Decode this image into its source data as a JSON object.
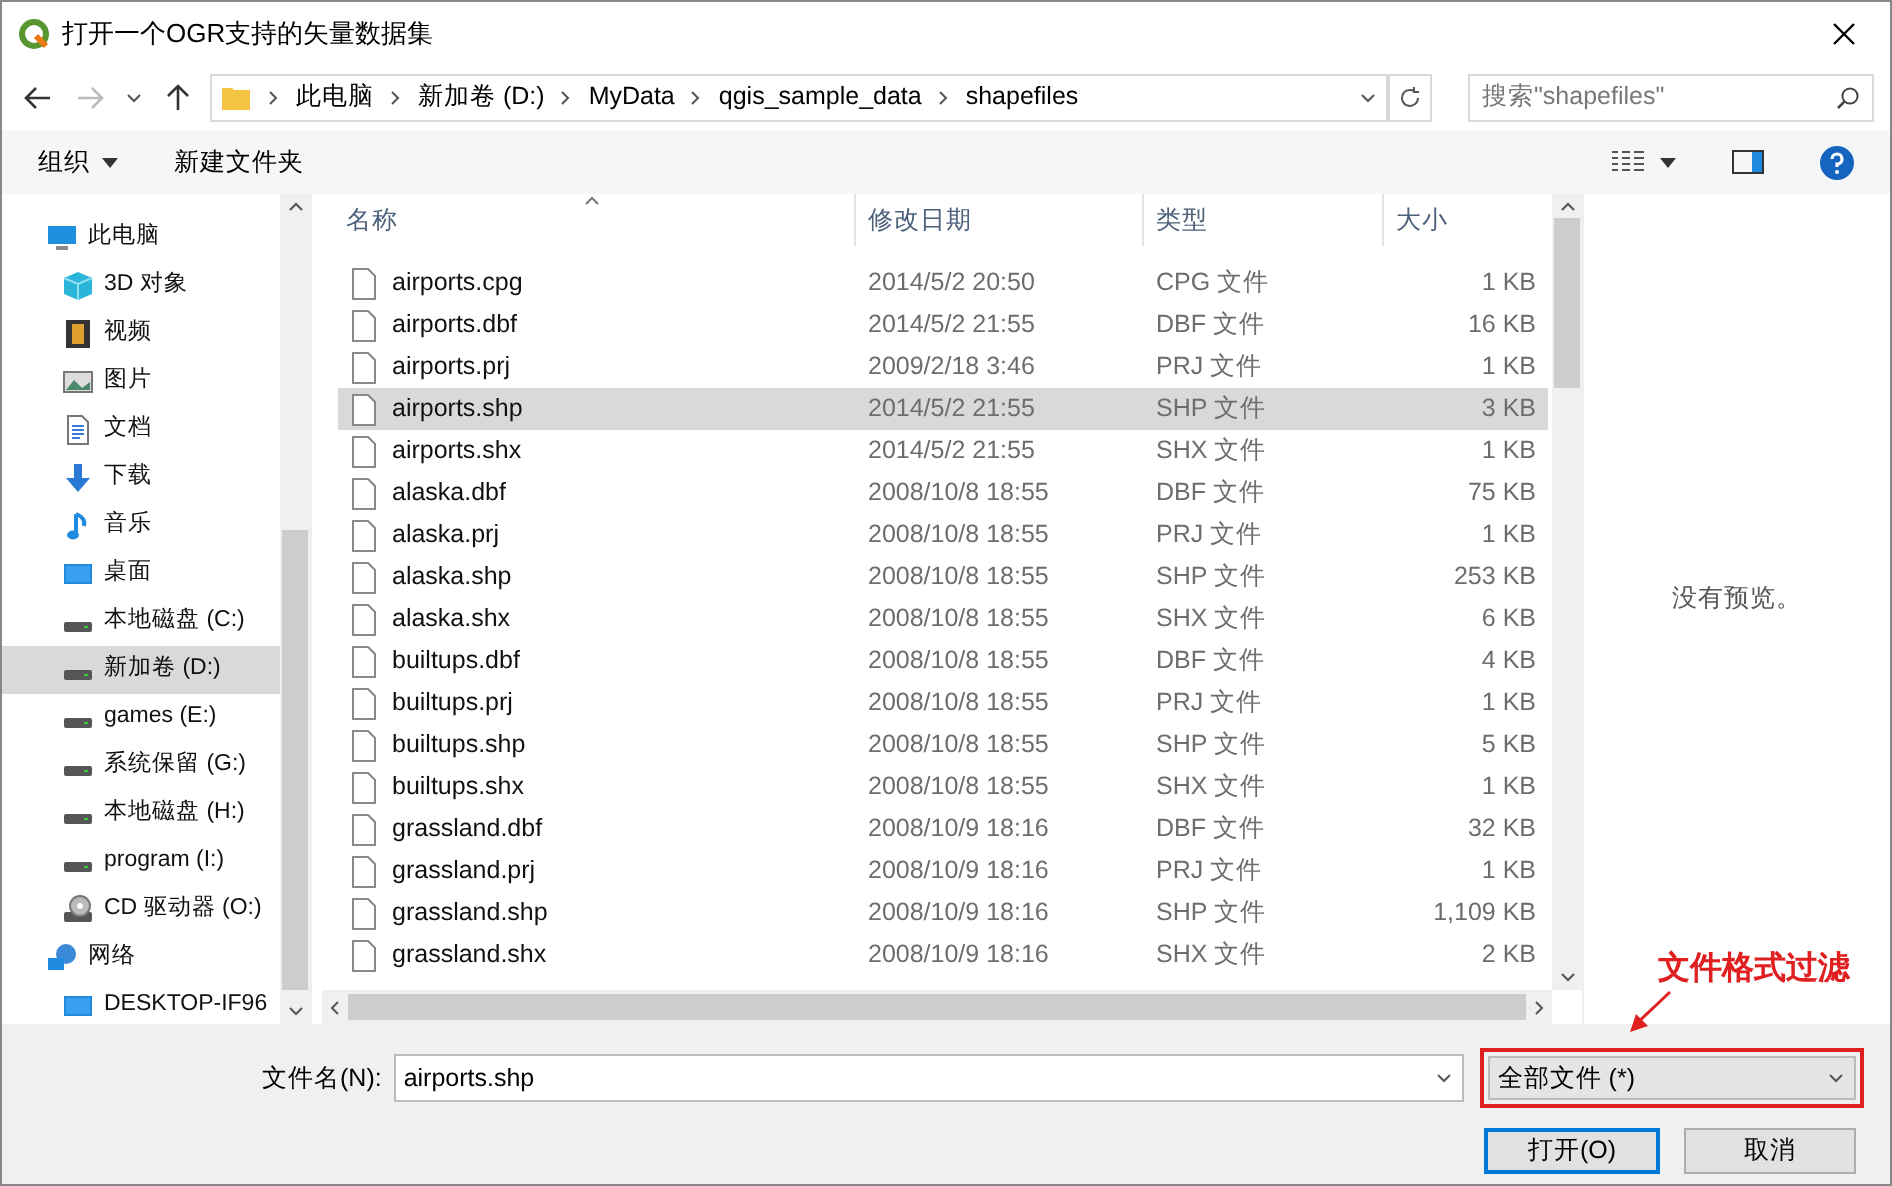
{
  "window": {
    "title": "打开一个OGR支持的矢量数据集"
  },
  "address": {
    "crumbs": [
      "此电脑",
      "新加卷 (D:)",
      "MyData",
      "qgis_sample_data",
      "shapefiles"
    ]
  },
  "search": {
    "placeholder": "搜索\"shapefiles\""
  },
  "toolbar": {
    "organize": "组织",
    "new_folder": "新建文件夹"
  },
  "sidebar": {
    "items": [
      {
        "label": "此电脑",
        "kind": "computer",
        "selected": false,
        "children": [
          {
            "label": "3D 对象",
            "kind": "cube",
            "selected": false
          },
          {
            "label": "视频",
            "kind": "video",
            "selected": false
          },
          {
            "label": "图片",
            "kind": "image",
            "selected": false
          },
          {
            "label": "文档",
            "kind": "document",
            "selected": false
          },
          {
            "label": "下载",
            "kind": "download",
            "selected": false
          },
          {
            "label": "音乐",
            "kind": "music",
            "selected": false
          },
          {
            "label": "桌面",
            "kind": "desktop",
            "selected": false
          },
          {
            "label": "本地磁盘 (C:)",
            "kind": "drive",
            "selected": false
          },
          {
            "label": "新加卷 (D:)",
            "kind": "drive",
            "selected": true
          },
          {
            "label": "games (E:)",
            "kind": "drive",
            "selected": false
          },
          {
            "label": "系统保留 (G:)",
            "kind": "drive",
            "selected": false
          },
          {
            "label": "本地磁盘 (H:)",
            "kind": "drive",
            "selected": false
          },
          {
            "label": "program (I:)",
            "kind": "drive",
            "selected": false
          },
          {
            "label": "CD 驱动器 (O:)",
            "kind": "cd",
            "selected": false
          }
        ]
      },
      {
        "label": "网络",
        "kind": "network",
        "selected": false,
        "children": [
          {
            "label": "DESKTOP-IF96",
            "kind": "desktop",
            "selected": false
          }
        ]
      }
    ]
  },
  "table": {
    "columns": [
      "名称",
      "修改日期",
      "类型",
      "大小"
    ],
    "rows": [
      {
        "name": "airports.cpg",
        "date": "2014/5/2 20:50",
        "type": "CPG 文件",
        "size": "1 KB",
        "selected": false
      },
      {
        "name": "airports.dbf",
        "date": "2014/5/2 21:55",
        "type": "DBF 文件",
        "size": "16 KB",
        "selected": false
      },
      {
        "name": "airports.prj",
        "date": "2009/2/18 3:46",
        "type": "PRJ 文件",
        "size": "1 KB",
        "selected": false
      },
      {
        "name": "airports.shp",
        "date": "2014/5/2 21:55",
        "type": "SHP 文件",
        "size": "3 KB",
        "selected": true
      },
      {
        "name": "airports.shx",
        "date": "2014/5/2 21:55",
        "type": "SHX 文件",
        "size": "1 KB",
        "selected": false
      },
      {
        "name": "alaska.dbf",
        "date": "2008/10/8 18:55",
        "type": "DBF 文件",
        "size": "75 KB",
        "selected": false
      },
      {
        "name": "alaska.prj",
        "date": "2008/10/8 18:55",
        "type": "PRJ 文件",
        "size": "1 KB",
        "selected": false
      },
      {
        "name": "alaska.shp",
        "date": "2008/10/8 18:55",
        "type": "SHP 文件",
        "size": "253 KB",
        "selected": false
      },
      {
        "name": "alaska.shx",
        "date": "2008/10/8 18:55",
        "type": "SHX 文件",
        "size": "6 KB",
        "selected": false
      },
      {
        "name": "builtups.dbf",
        "date": "2008/10/8 18:55",
        "type": "DBF 文件",
        "size": "4 KB",
        "selected": false
      },
      {
        "name": "builtups.prj",
        "date": "2008/10/8 18:55",
        "type": "PRJ 文件",
        "size": "1 KB",
        "selected": false
      },
      {
        "name": "builtups.shp",
        "date": "2008/10/8 18:55",
        "type": "SHP 文件",
        "size": "5 KB",
        "selected": false
      },
      {
        "name": "builtups.shx",
        "date": "2008/10/8 18:55",
        "type": "SHX 文件",
        "size": "1 KB",
        "selected": false
      },
      {
        "name": "grassland.dbf",
        "date": "2008/10/9 18:16",
        "type": "DBF 文件",
        "size": "32 KB",
        "selected": false
      },
      {
        "name": "grassland.prj",
        "date": "2008/10/9 18:16",
        "type": "PRJ 文件",
        "size": "1 KB",
        "selected": false
      },
      {
        "name": "grassland.shp",
        "date": "2008/10/9 18:16",
        "type": "SHP 文件",
        "size": "1,109 KB",
        "selected": false
      },
      {
        "name": "grassland.shx",
        "date": "2008/10/9 18:16",
        "type": "SHX 文件",
        "size": "2 KB",
        "selected": false
      }
    ]
  },
  "preview": {
    "message": "没有预览。"
  },
  "footer": {
    "filename_label": "文件名(N):",
    "filename": "airports.shp",
    "filter": "全部文件 (*)",
    "open_button": "打开(O)",
    "cancel_button": "取消"
  },
  "annotation": {
    "text": "文件格式过滤"
  }
}
